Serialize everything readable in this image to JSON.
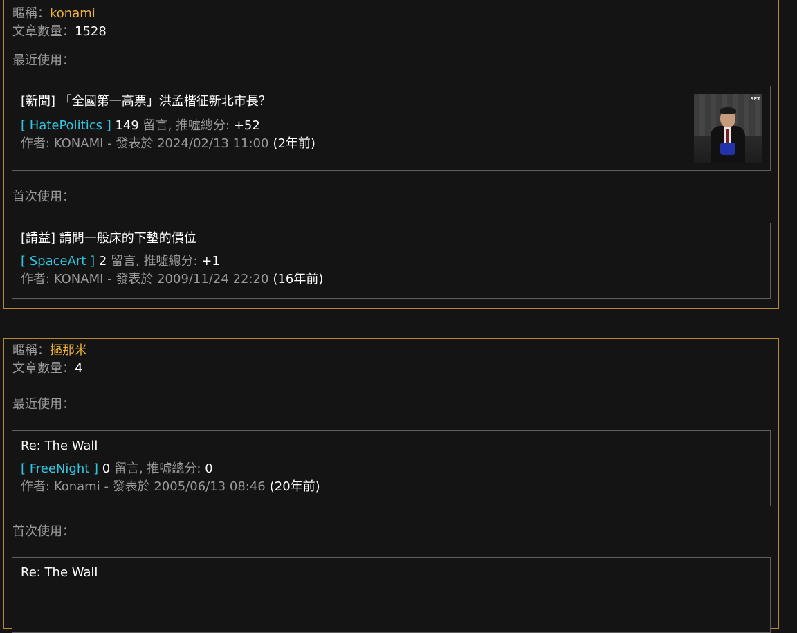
{
  "labels": {
    "nickname": "暱稱：",
    "article_count": "文章數量：",
    "recent_use": "最近使用：",
    "first_use": "首次使用：",
    "comments": "留言, 推噓總分:",
    "author_prefix": "作者:",
    "posted_at": "- 發表於"
  },
  "users": [
    {
      "nickname": "konami",
      "article_count": "1528",
      "recent": {
        "title": "[新聞] 「全國第一高票」洪孟楷征新北市長？",
        "board": "[ HatePolitics ]",
        "comments": "149",
        "score": "+52",
        "author": "KONAMI",
        "datetime": "2024/02/13 11:00",
        "ago": "(2年前)",
        "thumbnail": {
          "description": "news-photo-thumbnail",
          "logo": "SET"
        }
      },
      "first": {
        "title": "[請益] 請問一般床的下墊的價位",
        "board": "[ SpaceArt ]",
        "comments": "2",
        "score": "+1",
        "author": "KONAMI",
        "datetime": "2009/11/24 22:20",
        "ago": "(16年前)"
      }
    },
    {
      "nickname": "摳那米",
      "article_count": "4",
      "recent": {
        "title": "Re: The Wall",
        "board": "[ FreeNight ]",
        "comments": "0",
        "score": "0",
        "author": "Konami",
        "datetime": "2005/06/13 08:46",
        "ago": "(20年前)"
      },
      "first": {
        "title": "Re: The Wall"
      }
    }
  ],
  "colors": {
    "background": "#141414",
    "card_border": "#b8862d",
    "nickname": "#f0b33a",
    "board_link": "#31c6e0",
    "muted_text": "#9a9a9a",
    "post_border": "#5e5e5e"
  }
}
